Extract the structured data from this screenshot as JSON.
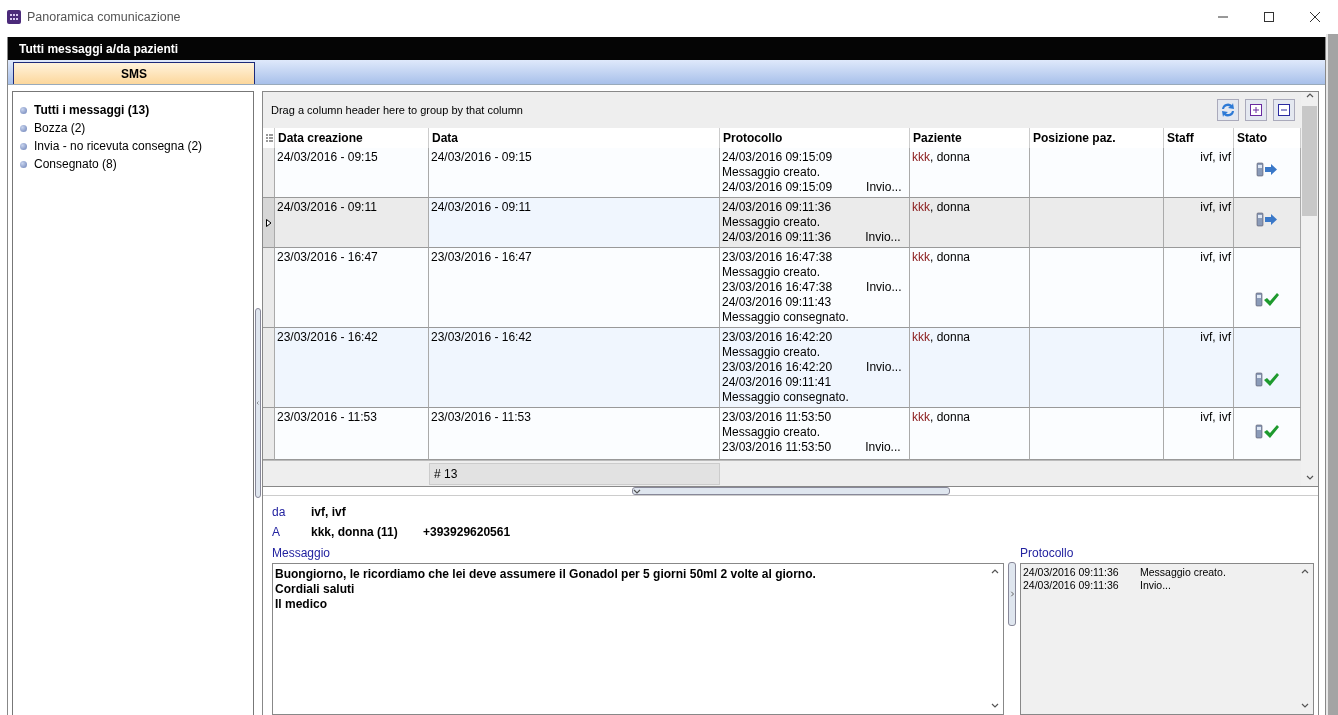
{
  "window": {
    "title": "Panoramica comunicazione"
  },
  "header": {
    "title": "Tutti messaggi a/da pazienti"
  },
  "tabs": [
    {
      "label": "SMS",
      "selected": true
    }
  ],
  "sidebar": {
    "items": [
      {
        "label": "Tutti i messaggi (13)",
        "selected": true
      },
      {
        "label": "Bozza (2)",
        "selected": false
      },
      {
        "label": "Invia - no ricevuta consegna (2)",
        "selected": false
      },
      {
        "label": "Consegnato (8)",
        "selected": false
      }
    ]
  },
  "grid": {
    "group_hint": "Drag a column header here to group by that column",
    "columns": [
      "Data creazione",
      "Data",
      "Protocollo",
      "Paziente",
      "Posizione paz.",
      "Staff",
      "Stato"
    ],
    "rows": [
      {
        "selected": false,
        "created": "24/03/2016 - 09:15",
        "date": "24/03/2016 - 09:15",
        "protocol": [
          [
            "24/03/2016 09:15:09"
          ],
          [
            "Messaggio creato."
          ],
          [
            "24/03/2016 09:15:09",
            "Invio..."
          ]
        ],
        "patient_surname": "kkk",
        "patient_rest": ", donna",
        "staff": "ivf, ivf",
        "status": {
          "kind": "sent"
        }
      },
      {
        "selected": true,
        "created": "24/03/2016 - 09:11",
        "date": "24/03/2016 - 09:11",
        "protocol": [
          [
            "24/03/2016 09:11:36"
          ],
          [
            "Messaggio creato."
          ],
          [
            "24/03/2016 09:11:36",
            "Invio..."
          ]
        ],
        "patient_surname": "kkk",
        "patient_rest": ", donna",
        "staff": "ivf, ivf",
        "status": {
          "kind": "sent"
        }
      },
      {
        "selected": false,
        "created": "23/03/2016 - 16:47",
        "date": "23/03/2016 - 16:47",
        "protocol": [
          [
            "23/03/2016 16:47:38"
          ],
          [
            "Messaggio creato."
          ],
          [
            "23/03/2016 16:47:38",
            "Invio..."
          ],
          [
            "24/03/2016 09:11:43"
          ],
          [
            "Messaggio consegnato."
          ]
        ],
        "patient_surname": "kkk",
        "patient_rest": ", donna",
        "staff": "ivf, ivf",
        "status": {
          "kind": "delivered"
        }
      },
      {
        "selected": false,
        "created": "23/03/2016 - 16:42",
        "date": "23/03/2016 - 16:42",
        "protocol": [
          [
            "23/03/2016 16:42:20"
          ],
          [
            "Messaggio creato."
          ],
          [
            "23/03/2016 16:42:20",
            "Invio..."
          ],
          [
            "24/03/2016 09:11:41"
          ],
          [
            "Messaggio consegnato."
          ]
        ],
        "patient_surname": "kkk",
        "patient_rest": ", donna",
        "staff": "ivf, ivf",
        "status": {
          "kind": "delivered"
        }
      },
      {
        "selected": false,
        "created": "23/03/2016 - 11:53",
        "date": "23/03/2016 - 11:53",
        "protocol": [
          [
            "23/03/2016 11:53:50"
          ],
          [
            "Messaggio creato."
          ],
          [
            "23/03/2016 11:53:50",
            "Invio..."
          ]
        ],
        "patient_surname": "kkk",
        "patient_rest": ", donna",
        "staff": "ivf, ivf",
        "status": {
          "kind": "delivered"
        }
      }
    ],
    "footer_count": "# 13"
  },
  "details": {
    "from_label": "da",
    "from_value": "ivf, ivf",
    "to_label": "A",
    "to_value": "kkk, donna (11)",
    "to_phone": "+393929620561",
    "message_label": "Messaggio",
    "message_lines": [
      "Buongiorno, le ricordiamo che lei deve assumere il Gonadol per 5 giorni 50ml 2 volte al giorno.",
      "Cordiali saluti",
      "Il medico"
    ],
    "protocol_label": "Protocollo",
    "protocol": [
      {
        "time": "24/03/2016 09:11:36",
        "text": "Messaggio creato."
      },
      {
        "time": "24/03/2016 09:11:36",
        "text": "Invio..."
      }
    ]
  }
}
